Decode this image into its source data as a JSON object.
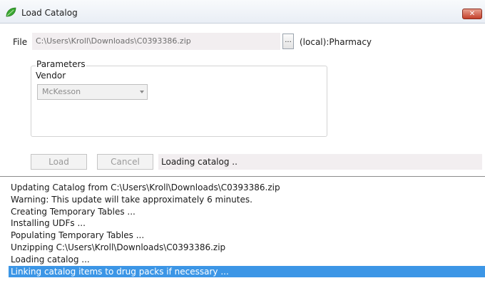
{
  "window": {
    "title": "Load Catalog",
    "close_glyph": "✕"
  },
  "file": {
    "label": "File",
    "path": "C:\\Users\\Kroll\\Downloads\\C0393386.zip",
    "browse_label": "...",
    "database": "(local):Pharmacy"
  },
  "parameters": {
    "legend": "Parameters",
    "vendor_label": "Vendor",
    "vendor_value": "McKesson"
  },
  "actions": {
    "load_label": "Load",
    "cancel_label": "Cancel",
    "status": "Loading catalog .."
  },
  "log": {
    "lines": [
      "Updating Catalog from C:\\Users\\Kroll\\Downloads\\C0393386.zip",
      "Warning: This update will take approximately 6 minutes.",
      "Creating Temporary Tables ...",
      "Installing UDFs ...",
      "Populating Temporary Tables ...",
      "Unzipping C:\\Users\\Kroll\\Downloads\\C0393386.zip",
      "Loading catalog   ...",
      "Linking catalog items to drug packs if necessary  ..."
    ],
    "selected_index": 7
  },
  "colors": {
    "selection": "#3c96e6",
    "title_icon": "#3aa832",
    "close_button": "#c4402a"
  },
  "icons": {
    "title": "leaf-icon",
    "close": "close-icon",
    "dropdown": "chevron-down-icon"
  }
}
